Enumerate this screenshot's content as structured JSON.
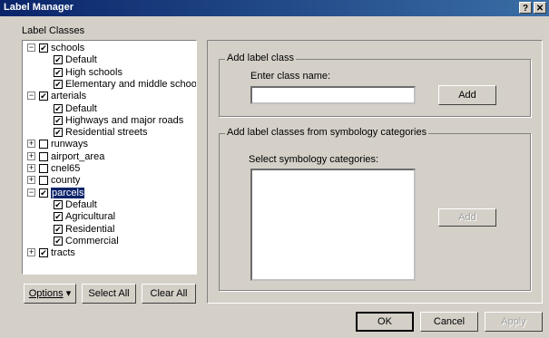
{
  "window": {
    "title": "Label Manager",
    "help_glyph": "?",
    "close_glyph": "✕"
  },
  "label_classes_heading": "Label Classes",
  "tree": [
    {
      "label": "schools",
      "expanded": true,
      "checked": true
    },
    {
      "label": "Default",
      "checked": true
    },
    {
      "label": "High schools",
      "checked": true
    },
    {
      "label": "Elementary and middle schools",
      "checked": true
    },
    {
      "label": "arterials",
      "expanded": true,
      "checked": true
    },
    {
      "label": "Default",
      "checked": true
    },
    {
      "label": "Highways and major roads",
      "checked": true
    },
    {
      "label": "Residential streets",
      "checked": true
    },
    {
      "label": "runways",
      "expanded": false,
      "checked": false
    },
    {
      "label": "airport_area",
      "expanded": false,
      "checked": false
    },
    {
      "label": "cnel65",
      "expanded": false,
      "checked": false
    },
    {
      "label": "county",
      "expanded": false,
      "checked": false
    },
    {
      "label": "parcels",
      "expanded": true,
      "checked": true,
      "selected": true
    },
    {
      "label": "Default",
      "checked": true
    },
    {
      "label": "Agricultural",
      "checked": true
    },
    {
      "label": "Residential",
      "checked": true
    },
    {
      "label": "Commercial",
      "checked": true
    },
    {
      "label": "tracts",
      "expanded": false,
      "checked": true
    }
  ],
  "tree_buttons": {
    "options": "Options",
    "options_arrow": "▾",
    "select_all": "Select All",
    "clear_all": "Clear All"
  },
  "add_label_class": {
    "group_label": "Add label class",
    "field_label": "Enter class name:",
    "value": "",
    "add_button": "Add"
  },
  "add_from_symbology": {
    "group_label": "Add label classes from symbology categories",
    "field_label": "Select symbology categories:",
    "add_button": "Add"
  },
  "footer": {
    "ok": "OK",
    "cancel": "Cancel",
    "apply": "Apply"
  },
  "glyphs": {
    "plus": "+",
    "minus": "−",
    "check": "✔"
  }
}
